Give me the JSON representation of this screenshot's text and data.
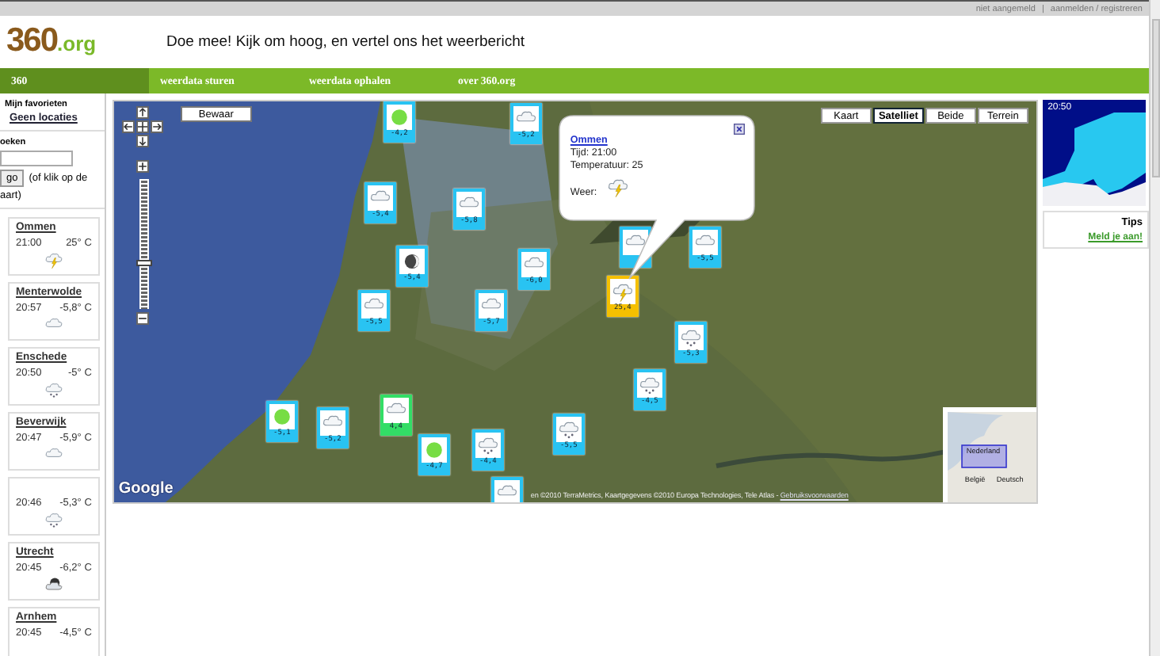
{
  "top_bar": {
    "status": "niet aangemeld",
    "separator": "|",
    "link": "aanmelden / registreren"
  },
  "header": {
    "logo": {
      "number": "360",
      "suffix": ".org"
    },
    "tagline": "Doe mee! Kijk om hoog, en vertel ons het weerbericht"
  },
  "nav": [
    {
      "label": "360",
      "selected": true
    },
    {
      "label": "weerdata sturen",
      "selected": false
    },
    {
      "label": "weerdata ophalen",
      "selected": false
    },
    {
      "label": "over 360.org",
      "selected": false
    }
  ],
  "sidebar": {
    "favorites_title": "Mijn favorieten",
    "favorites_link": "Geen locaties",
    "search_title": "oeken",
    "go_button": "go",
    "hint_1": "(of klik op de",
    "hint_2": "aart)",
    "stations": [
      {
        "name": "Ommen",
        "time": "21:00",
        "temperature": "25° C",
        "kind": "storm"
      },
      {
        "name": "Menterwolde",
        "time": "20:57",
        "temperature": "-5,8° C",
        "kind": "cloud"
      },
      {
        "name": "Enschede",
        "time": "20:50",
        "temperature": "-5° C",
        "kind": "snow"
      },
      {
        "name": "Beverwijk",
        "time": "20:47",
        "temperature": "-5,9° C",
        "kind": "cloud"
      },
      {
        "time": "20:46",
        "temperature": "-5,3° C",
        "kind": "snow"
      },
      {
        "name": "Utrecht",
        "time": "20:45",
        "temperature": "-6,2° C",
        "kind": "night-cloud"
      },
      {
        "name": "Arnhem",
        "time": "20:45",
        "temperature": "-4,5° C"
      }
    ]
  },
  "map": {
    "save_button": "Bewaar",
    "zoom_slider": {
      "level": 0.35
    },
    "map_types": [
      {
        "label": "Kaart",
        "selected": false
      },
      {
        "label": "Satelliet",
        "selected": true
      },
      {
        "label": "Beide",
        "selected": false
      },
      {
        "label": "Terrein",
        "selected": false
      }
    ],
    "markers": [
      {
        "kind": "clear",
        "reading": "-4,2",
        "color": "#29c3f2"
      },
      {
        "kind": "cloud",
        "reading": "-5,2",
        "color": "#29c3f2"
      },
      {
        "kind": "cloud",
        "reading": "-5,4",
        "color": "#29c3f2"
      },
      {
        "kind": "cloud",
        "reading": "-5,8",
        "color": "#29c3f2"
      },
      {
        "kind": "moon",
        "reading": "-5,4",
        "color": "#29c3f2"
      },
      {
        "kind": "cloud",
        "reading": "-6,0",
        "color": "#29c3f2"
      },
      {
        "kind": "cloud",
        "reading": "-5,5",
        "color": "#29c3f2"
      },
      {
        "kind": "cloud",
        "reading": "-5,7",
        "color": "#29c3f2"
      },
      {
        "kind": "cloud",
        "color": "#29c3f2"
      },
      {
        "kind": "cloud",
        "reading": "-5,5",
        "color": "#29c3f2"
      },
      {
        "kind": "storm",
        "reading": "25,4",
        "color": "#f5c000"
      },
      {
        "kind": "snow",
        "reading": "-5,3",
        "color": "#29c3f2"
      },
      {
        "kind": "snow",
        "reading": "-4,5",
        "color": "#29c3f2"
      },
      {
        "kind": "clear",
        "reading": "-5,1",
        "color": "#29c3f2"
      },
      {
        "kind": "cloud",
        "reading": "-5,2",
        "color": "#29c3f2"
      },
      {
        "kind": "cloud",
        "reading": "4,4",
        "color": "#33dd66"
      },
      {
        "kind": "clear",
        "reading": "-4,7",
        "color": "#29c3f2"
      },
      {
        "kind": "snow",
        "reading": "-4,4",
        "color": "#29c3f2"
      },
      {
        "kind": "snow",
        "reading": "-5,5",
        "color": "#29c3f2"
      },
      {
        "kind": "cloud",
        "color": "#29c3f2"
      }
    ],
    "balloon": {
      "place": "Ommen",
      "time": "Tijd: 21:00",
      "temperature": "Temperatuur: 25",
      "weather_label": "Weer:",
      "weather_icon": {
        "kind": "storm"
      }
    },
    "logo": "Google",
    "attribution": "en ©2010 TerraMetrics, Kaartgegevens ©2010 Europa Technologies, Tele Atlas - ",
    "terms_link": "Gebruiksvoorwaarden",
    "overview_labels": [
      "Nederland",
      "België",
      "Deutsch"
    ]
  },
  "right_panel": {
    "radar_time": "20:50",
    "tips_title": "Tips",
    "tips_link": "Meld je aan!"
  }
}
